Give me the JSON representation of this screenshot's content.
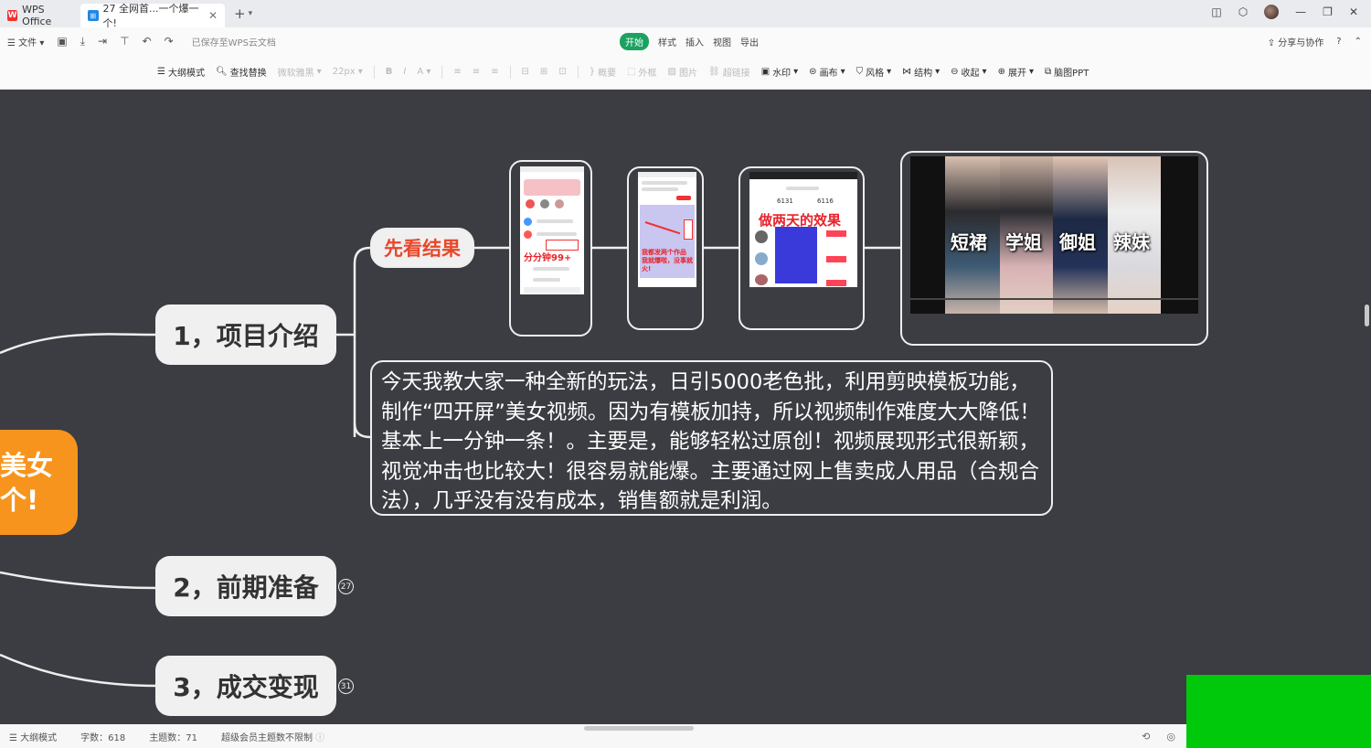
{
  "tabs": {
    "home_label": "WPS Office",
    "doc_label": "27 全网首...一个爆一个!"
  },
  "menubar": {
    "file_label": "文件",
    "saved_status": "已保存至WPS云文档",
    "menus": [
      "开始",
      "样式",
      "插入",
      "视图",
      "导出"
    ],
    "share_label": "分享与协作",
    "help_label": "?"
  },
  "toolbar": {
    "outline_mode": "大纲模式",
    "find_replace": "查找替换",
    "font_family": "微软雅黑",
    "font_size": "22px",
    "summary": "概要",
    "outer_frame": "外框",
    "image": "图片",
    "hyperlink": "超链接",
    "watermark": "水印",
    "canvas": "画布",
    "style": "风格",
    "structure": "结构",
    "collapse": "收起",
    "expand": "展开",
    "to_ppt": "脑图PPT"
  },
  "mindmap": {
    "central_line1": "美女",
    "central_line2": "个!",
    "topic1": "1，项目介绍",
    "topic2": "2，前期准备",
    "topic2_count": "27",
    "topic3": "3，成交变现",
    "topic3_count": "31",
    "result_label": "先看结果",
    "description": "今天我教大家一种全新的玩法，日引5000老色批，利用剪映模板功能，制作“四开屏”美女视频。因为有模板加持，所以视频制作难度大大降低！基本上一分钟一条！。主要是，能够轻松过原创！视频展现形式很新颖，视觉冲击也比较大！很容易就能爆。主要通过网上售卖成人用品（合规合法），几乎没有没有成本，销售额就是利润。",
    "shot1_text": "分分钟99+",
    "shot2_text": "我都发两个作品 我就爆啦，没事就火!",
    "shot3_text": "做两天的效果",
    "shot3_stat1": "6131",
    "shot3_stat2": "6116",
    "collage_labels": [
      "短裙",
      "学姐",
      "御姐",
      "辣妹"
    ]
  },
  "statusbar": {
    "mode": "大纲模式",
    "word_count": "字数：618",
    "topic_count": "主题数：71",
    "vip_note": "超级会员主题数不限制"
  },
  "colors": {
    "canvas_bg": "#3b3d42",
    "central_orange": "#f7941d",
    "result_red": "#e8472a",
    "active_green": "#1aa260"
  }
}
